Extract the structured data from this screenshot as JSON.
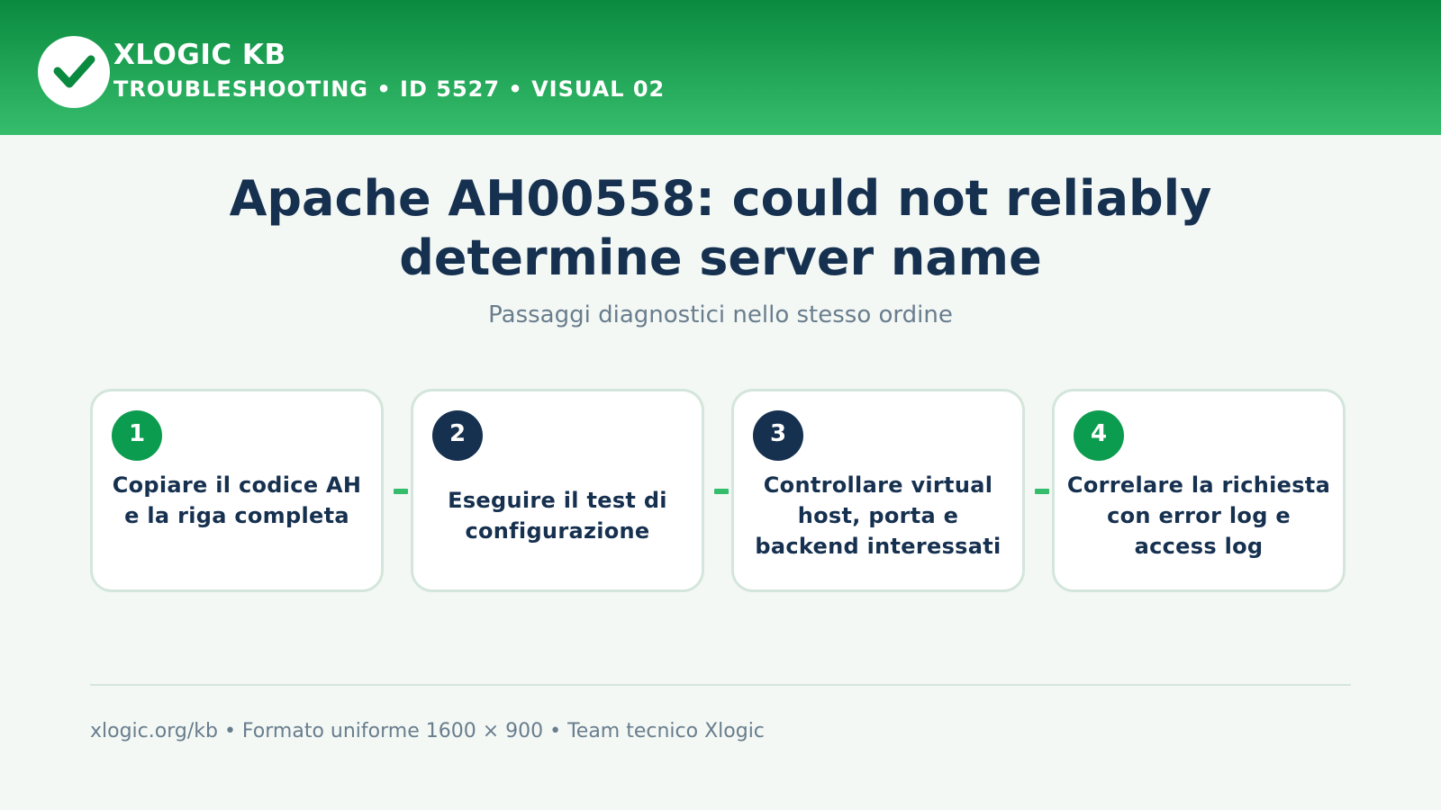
{
  "header": {
    "brand": "XLOGIC KB",
    "meta": "TROUBLESHOOTING • ID 5527 • VISUAL 02",
    "logo_icon": "check-icon"
  },
  "main": {
    "title": "Apache AH00558: could not reliably determine server name",
    "subtitle": "Passaggi diagnostici nello stesso ordine"
  },
  "steps": [
    {
      "number": "1",
      "text": "Copiare il codice AH e la riga completa",
      "badge_color": "#0c9c4f"
    },
    {
      "number": "2",
      "text": "Eseguire il test di configurazione",
      "badge_color": "#16304f"
    },
    {
      "number": "3",
      "text": "Controllare virtual host, porta e backend interessati",
      "badge_color": "#16304f"
    },
    {
      "number": "4",
      "text": "Correlare la richiesta con error log e access log",
      "badge_color": "#0c9c4f"
    }
  ],
  "footer": {
    "text": "xlogic.org/kb • Formato uniforme 1600 × 900 • Team tecnico Xlogic"
  },
  "colors": {
    "header_green_dark": "#0a8a3f",
    "header_green_light": "#36bd6c",
    "navy": "#16304f",
    "accent_green": "#0c9c4f",
    "background": "#f3f8f5"
  }
}
